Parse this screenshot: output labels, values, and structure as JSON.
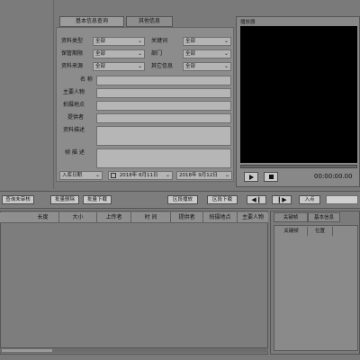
{
  "tabs": [
    {
      "label": "基本信息查询"
    },
    {
      "label": "其他信息"
    }
  ],
  "video_panel": {
    "title": "播放器",
    "timecode": "00:00:00.00"
  },
  "search_form": {
    "row1": {
      "label_left": "资料类型",
      "value_left": "全部",
      "label_right": "关键词",
      "value_right": "全部"
    },
    "row2": {
      "label_left": "保管期限",
      "value_left": "全部",
      "label_right": "部门",
      "value_right": "全部"
    },
    "row3": {
      "label_left": "资料来源",
      "value_left": "全部",
      "label_right": "其它信息",
      "value_right": "全部"
    },
    "text_fields": [
      {
        "label": "名 称"
      },
      {
        "label": "主要人物"
      },
      {
        "label": "拍摄地点"
      },
      {
        "label": "提供者"
      },
      {
        "label": "资料描述"
      },
      {
        "label": "帧 描 述"
      }
    ],
    "date_type": "入库日期",
    "date_from": "2018年 8月11日",
    "date_to": "2018年 9月12日"
  },
  "toolbar": {
    "review_button": "查询未审核",
    "batch_delete_button": "批量删除",
    "batch_download_button": "批量下载",
    "segment_play_button": "区段播放",
    "segment_download_button": "区段下载",
    "in_point_button": "入点"
  },
  "table": {
    "columns": [
      "长度",
      "大小",
      "上传者",
      "时 间",
      "提供者",
      "拍摄地点",
      "主要人物"
    ]
  },
  "right_panel": {
    "tabs": [
      "关键帧",
      "基本信息"
    ],
    "columns": [
      "关键帧",
      "位置"
    ]
  }
}
